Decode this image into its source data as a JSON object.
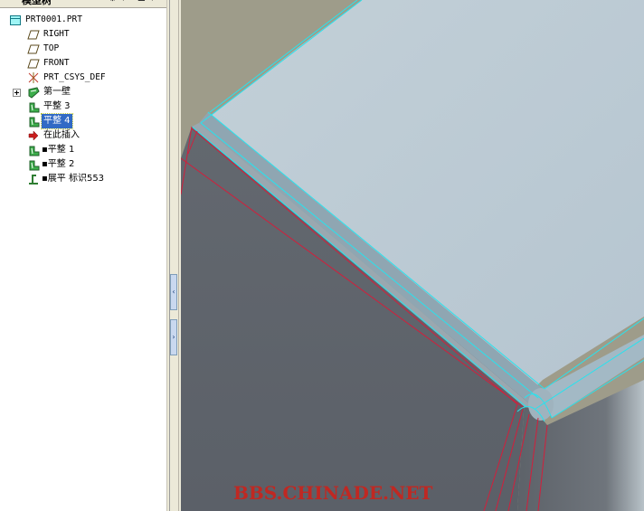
{
  "panel": {
    "title": "模型树",
    "settings_button_glyph": "⚙",
    "show_button_glyph": "☰",
    "dropdown_caret": "▾"
  },
  "tree": {
    "root": {
      "label": "PRT0001.PRT",
      "icon": "part-icon"
    },
    "items": [
      {
        "label": "RIGHT",
        "icon": "datum-plane-icon"
      },
      {
        "label": "TOP",
        "icon": "datum-plane-icon"
      },
      {
        "label": "FRONT",
        "icon": "datum-plane-icon"
      },
      {
        "label": "PRT_CSYS_DEF",
        "icon": "coordinate-system-icon"
      },
      {
        "label": "第一壁",
        "icon": "sheetmetal-wall-icon"
      },
      {
        "label": "平整 3",
        "icon": "flat-wall-icon"
      },
      {
        "label": "平整 4",
        "icon": "flat-wall-icon",
        "selected": true
      },
      {
        "label": "在此插入",
        "icon": "insert-here-arrow-icon"
      },
      {
        "label": "▪平整 1",
        "icon": "flat-wall-icon"
      },
      {
        "label": "▪平整 2",
        "icon": "flat-wall-icon"
      },
      {
        "label": "▪展平 标识553",
        "icon": "unbend-icon"
      }
    ]
  },
  "splitter": {
    "collapse_glyph": "‹",
    "expand_glyph": "›"
  },
  "viewport": {
    "watermark": "BBS.CHINADE.NET",
    "colors": {
      "background": "#9e9c8a",
      "top_face": "#bccbd5",
      "side_face": "#5f646b",
      "edge_cyan": "#27e3ee",
      "edge_red": "#d21f3c"
    }
  }
}
